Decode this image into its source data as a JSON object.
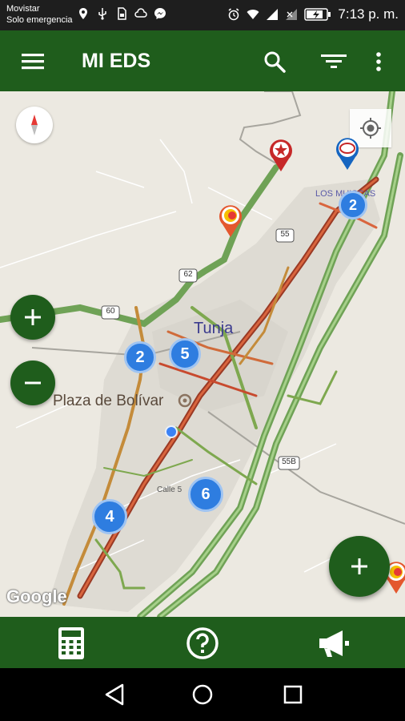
{
  "status_bar": {
    "carrier": "Movistar",
    "carrier_sub": "Solo emergencia",
    "time": "7:13 p. m.",
    "icons": [
      "location-icon",
      "usb-icon",
      "sim-icon",
      "cloud-icon",
      "messenger-icon",
      "alarm-icon",
      "wifi-icon",
      "signal-icon",
      "battery-charging-icon"
    ]
  },
  "toolbar": {
    "title": "MI EDS",
    "menu_icon": "menu-icon",
    "search_icon": "search-icon",
    "filter_icon": "filter-icon",
    "more_icon": "more-vert-icon"
  },
  "map": {
    "city_label": "Tunja",
    "place_label": "Plaza de Bolívar",
    "neighborhood_label": "LOS MUISCAS",
    "street_label": "Calle 5",
    "road_labels": [
      "55",
      "62",
      "60",
      "55B"
    ],
    "google_logo": "Google",
    "clusters": [
      "2",
      "2",
      "5",
      "6",
      "4"
    ],
    "station_pins": [
      "texaco-pin-icon",
      "esso-pin-icon",
      "station-pin-icon",
      "station-pin-icon"
    ],
    "colors": {
      "cluster": "#2e7de0",
      "primary": "#1f5d1c"
    }
  },
  "controls": {
    "zoom_in": "+",
    "zoom_out": "−",
    "fab": "+"
  },
  "bottom_bar": {
    "calculator_icon": "calculator-icon",
    "help_icon": "help-icon",
    "announce_icon": "megaphone-icon"
  },
  "nav_bar": {
    "back_icon": "back-icon",
    "home_icon": "home-icon",
    "recents_icon": "recents-icon"
  }
}
